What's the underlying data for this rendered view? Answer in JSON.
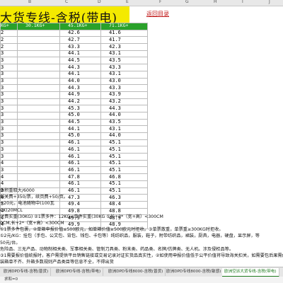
{
  "sheet": {
    "columns": [
      "B",
      "C",
      "D",
      "E",
      "F",
      "G",
      "H",
      "I",
      "J"
    ],
    "title": "大货专线-含税(带电)",
    "back_link": "返回目录"
  },
  "table": {
    "headers": [
      "KG+",
      "30.1KG+",
      "45.1KG+",
      "71.1KG+"
    ],
    "rows": [
      [
        "2",
        "42.6",
        "41.6"
      ],
      [
        "2",
        "42.7",
        "41.7"
      ],
      [
        "2",
        "43.3",
        "42.3"
      ],
      [
        "3",
        "44.1",
        "43.1"
      ],
      [
        "3",
        "44.5",
        "43.5"
      ],
      [
        "3",
        "44.3",
        "43.3"
      ],
      [
        "3",
        "44.1",
        "43.1"
      ],
      [
        "3",
        "44.0",
        "43.0"
      ],
      [
        "3",
        "44.3",
        "43.3"
      ],
      [
        "3",
        "44.9",
        "43.9"
      ],
      [
        "3",
        "44.2",
        "43.2"
      ],
      [
        "3",
        "45.3",
        "44.3"
      ],
      [
        "3",
        "45.0",
        "44.0"
      ],
      [
        "3",
        "44.5",
        "43.5"
      ],
      [
        "3",
        "44.1",
        "43.1"
      ],
      [
        "3",
        "45.0",
        "44.0"
      ],
      [
        "3",
        "46.1",
        "45.1"
      ],
      [
        "3",
        "46.1",
        "45.1"
      ],
      [
        "3",
        "46.1",
        "45.1"
      ],
      [
        "4",
        "46.1",
        "45.1"
      ],
      [
        "3",
        "46.1",
        "45.1"
      ],
      [
        "4",
        "47.8",
        "46.8"
      ],
      [
        "4",
        "46.1",
        "45.1"
      ],
      [
        "3",
        "46.1",
        "45.1"
      ],
      [
        "4",
        "47.3",
        "46.3"
      ],
      [
        "3",
        "49.4",
        "48.4"
      ],
      [
        "4",
        "49.8",
        "48.8"
      ],
      [
        "4",
        "49.9",
        "48.9"
      ],
      [
        "4",
        "49.9",
        "48.9"
      ]
    ]
  },
  "notes": [
    "体积重取大/6000",
    "报关费+350/票，续页费+50/页。",
    "+20元，电池随物中(100瓦",
    "CK(20MCL",
    "计费实重(30KG)  ②1票多件：12KG≤单件实重(30KG  ①长+2*（宽+高）<300CM",
    "0CM,长+2*（宽+高）<300CM",
    "①1票多件包裹，②单箱申报价值≤500欧元，如单箱价值≥500欧元时拒收。③单票散重，单票重≥300KG时拒收。",
    "①2元/KG：挂包（手包、公文包、背包、钱包、卡包等）纯纺织品，服装，鞋子，附带纺织品，裙装，厨具，电器，硬盘，显示屏，等",
    "50元/台。",
    "危险品、三无产品、动物制相关类、军事相关类、管制刀具类、粉末类、药品类、名牌/仿牌类、无人机、涉及侵权品等。",
    "③1需要报价值统报时，客户需提供平台销售链接或交易记录对证实货品真实性，②如使用申报价值低于公平价值将导致海关扣关，如需要包后果需由",
    "装箱单不齐、外箱多数规则产品类目等信息不全，不得出货"
  ],
  "tabs": [
    {
      "label": "欧洲DPD专线-含税(普货)",
      "active": false
    },
    {
      "label": "欧洲DPD专线-含税(带电)",
      "active": false
    },
    {
      "label": "欧洲DPD专线8000-含税(普货)",
      "active": false
    },
    {
      "label": "欧洲DPD专线8000-含税(敏感)",
      "active": false
    },
    {
      "label": "欧洲空派大货专线-含税(带电)",
      "active": true
    }
  ],
  "status": "求和=0"
}
